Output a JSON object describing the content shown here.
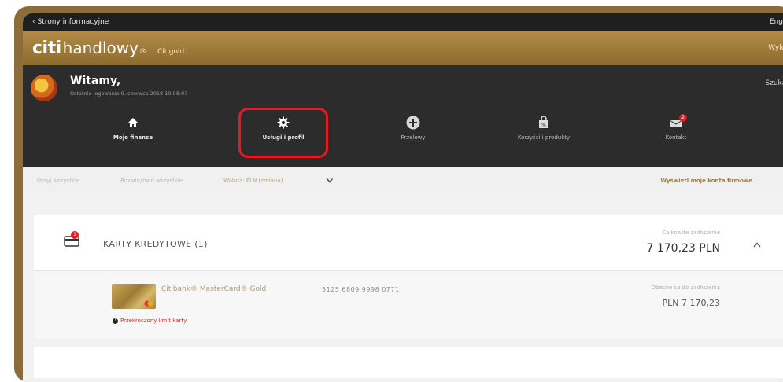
{
  "topbar": {
    "back_label": "‹ Strony informacyjne",
    "lang_label": "Engli"
  },
  "brand": {
    "citi": "citi",
    "handlowy": "handlowy",
    "tm": "®",
    "segment": "Citigold",
    "logout": "Wylog"
  },
  "welcome": {
    "greeting": "Witamy,",
    "last_login": "Ostatnie logowanie 9. czerwca 2018 10:58:07",
    "search": "Szukaj ("
  },
  "nav": [
    {
      "label": "Moje finanse",
      "icon": "home-icon"
    },
    {
      "label": "Usługi i profil",
      "icon": "gear-icon"
    },
    {
      "label": "Przelewy",
      "icon": "plus-circle-icon"
    },
    {
      "label": "Korzyści i produkty",
      "icon": "shopping-bag-icon"
    },
    {
      "label": "Kontakt",
      "icon": "mail-icon",
      "badge": "2"
    }
  ],
  "subnav": {
    "hide_balances": "Ukryj wszystkie",
    "expand_all": "Rozwiń/zwiń wszystkie",
    "currency": "Waluta: PLN (zmiana)",
    "show_company": "Wyświetl moje konta firmowe"
  },
  "cards_section": {
    "badge": "1",
    "title": "KARTY KREDYTOWE (1)",
    "total_label": "Całkowite zadłużenie",
    "total_value": "7 170,23 PLN",
    "card": {
      "name": "Citibank® MasterCard® Gold",
      "number": "5125 6809 9998 0771",
      "balance_label": "Obecne saldo zadłużenia",
      "balance_value": "PLN 7 170,23",
      "warning": "Przekroczony limit karty."
    }
  },
  "colors": {
    "accent_red": "#e51b24",
    "gold": "#9c7f45",
    "header_dark": "#2c2c2c"
  }
}
